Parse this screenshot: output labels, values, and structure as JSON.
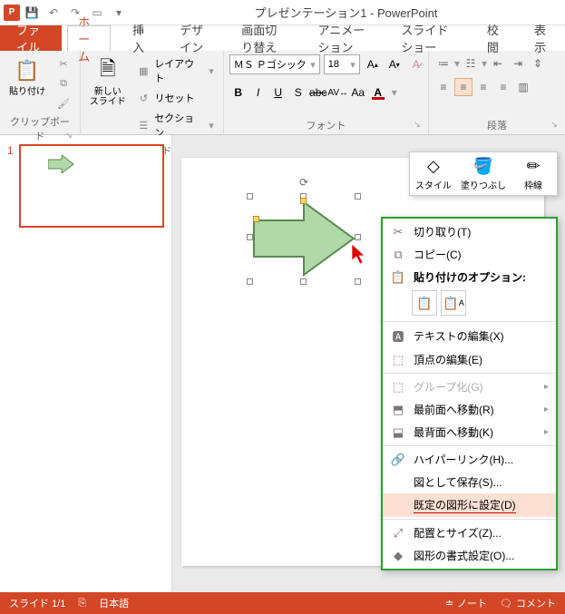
{
  "title": "プレゼンテーション1 - PowerPoint",
  "tabs": {
    "file": "ファイル",
    "home": "ホーム",
    "insert": "挿入",
    "design": "デザイン",
    "transitions": "画面切り替え",
    "animations": "アニメーション",
    "slideshow": "スライド ショー",
    "review": "校閲",
    "view": "表示"
  },
  "ribbon": {
    "clipboard": {
      "label": "クリップボード",
      "paste": "貼り付け"
    },
    "slides": {
      "label": "スライド",
      "newslide": "新しい\nスライド",
      "layout": "レイアウト",
      "reset": "リセット",
      "section": "セクション"
    },
    "font": {
      "label": "フォント",
      "name": "ＭＳ Ｐゴシック",
      "size": "18"
    },
    "paragraph": {
      "label": "段落"
    }
  },
  "thumb_num": "1",
  "mini": {
    "style": "スタイル",
    "fill": "塗りつぶし",
    "outline": "枠線"
  },
  "ctx": {
    "cut": "切り取り(T)",
    "copy": "コピー(C)",
    "paste_label": "貼り付けのオプション:",
    "edit_text": "テキストの編集(X)",
    "edit_points": "頂点の編集(E)",
    "group": "グループ化(G)",
    "bring_front": "最前面へ移動(R)",
    "send_back": "最背面へ移動(K)",
    "hyperlink": "ハイパーリンク(H)...",
    "save_pic": "図として保存(S)...",
    "set_default": "既定の図形に設定(D)",
    "size_pos": "配置とサイズ(Z)...",
    "format_shape": "図形の書式設定(O)..."
  },
  "status": {
    "slide": "スライド 1/1",
    "lang": "日本語",
    "notes": "ノート",
    "comments": "コメント"
  }
}
